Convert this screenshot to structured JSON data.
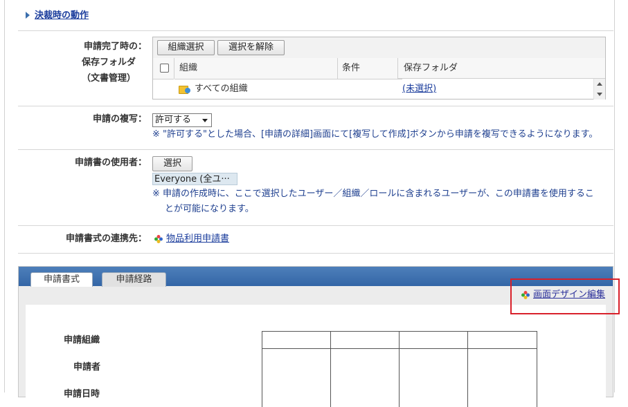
{
  "section_toggle": {
    "label": "決裁時の動作"
  },
  "save_folder": {
    "label_lines": [
      "申請完了時の：",
      "保存フォルダ",
      "（文書管理）"
    ],
    "buttons": {
      "select_org": "組織選択",
      "clear": "選択を解除"
    },
    "columns": [
      "組織",
      "条件",
      "保存フォルダ"
    ],
    "rows": [
      {
        "org": "すべての組織",
        "condition": "",
        "folder": "(未選択)"
      }
    ]
  },
  "copy_setting": {
    "label": "申請の複写：",
    "selected": "許可する",
    "note": "※ \"許可する\"とした場合、[申請の詳細]画面にて[複写して作成]ボタンから申請を複写できるようになります。"
  },
  "users": {
    "label": "申請書の使用者：",
    "select_button": "選択",
    "chip": "Everyone (全ユ···",
    "note_line1": "※ 申請の作成時に、ここで選択したユーザー／組織／ロールに含まれるユーザーが、この申請書を使用するこ",
    "note_line2": "とが可能になります。"
  },
  "link_target": {
    "label": "申請書式の連携先：",
    "value": "物品利用申請書"
  },
  "tabs": [
    {
      "label": "申請書式",
      "active": true
    },
    {
      "label": "申請経路",
      "active": false
    }
  ],
  "design_edit": {
    "label": "画面デザイン編集"
  },
  "form_preview": {
    "labels": [
      "申請組織",
      "申請者",
      "申請日時"
    ]
  },
  "colors": {
    "link": "#1a3c9c",
    "note": "#1e3f8f",
    "panel_header": "#3a6ead",
    "highlight": "#d9202a"
  }
}
